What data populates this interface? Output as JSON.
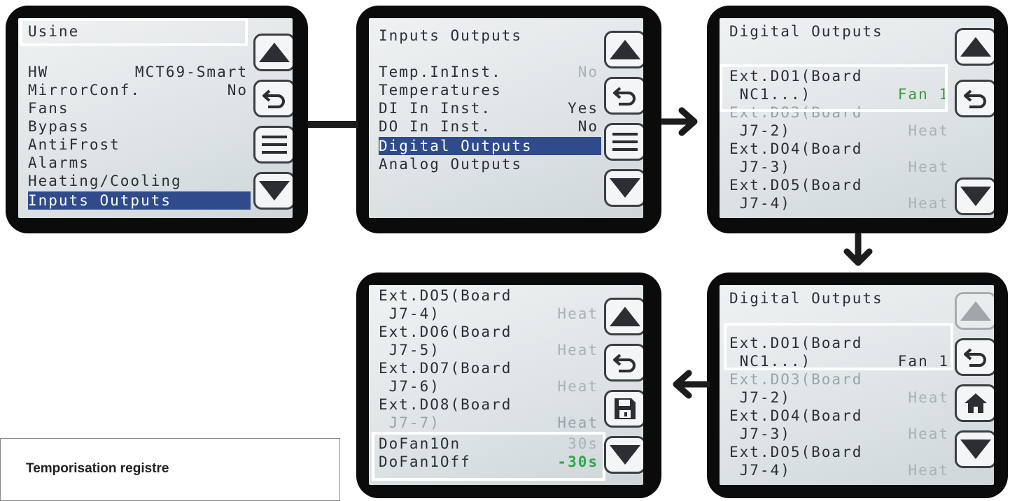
{
  "screens": {
    "s1": {
      "lines": [
        {
          "t": "Usine",
          "r": ""
        },
        {
          "t": "",
          "r": ""
        },
        {
          "t": "HW",
          "r": "MCT69-Smart"
        },
        {
          "t": "MirrorConf.",
          "r": "No"
        },
        {
          "t": "Fans",
          "r": ""
        },
        {
          "t": "Bypass",
          "r": ""
        },
        {
          "t": "AntiFrost",
          "r": ""
        },
        {
          "t": "Alarms",
          "r": ""
        },
        {
          "t": "Heating/Cooling",
          "r": ""
        },
        {
          "t": "Inputs Outputs",
          "r": ""
        }
      ]
    },
    "s2": {
      "lines": [
        {
          "t": "Inputs Outputs",
          "r": ""
        },
        {
          "t": "Temp.InInst.",
          "r": "No"
        },
        {
          "t": "Temperatures",
          "r": ""
        },
        {
          "t": "DI In Inst.",
          "r": "Yes"
        },
        {
          "t": "DO In Inst.",
          "r": "No"
        },
        {
          "t": "Digital Outputs",
          "r": ""
        },
        {
          "t": "Analog Outputs",
          "r": ""
        }
      ]
    },
    "s3": {
      "lines": [
        {
          "t": "Digital Outputs",
          "r": ""
        },
        {
          "t": "Ext.DO1(Board",
          "r": ""
        },
        {
          "t": " NC1...)",
          "r": "Fan 1"
        },
        {
          "t": "Ext.DO3(Board",
          "r": ""
        },
        {
          "t": " J7-2)",
          "r": "Heat"
        },
        {
          "t": "Ext.DO4(Board",
          "r": ""
        },
        {
          "t": " J7-3)",
          "r": "Heat"
        },
        {
          "t": "Ext.DO5(Board",
          "r": ""
        },
        {
          "t": " J7-4)",
          "r": "Heat"
        }
      ]
    },
    "s4": {
      "lines": [
        {
          "t": "Digital Outputs",
          "r": ""
        },
        {
          "t": "Ext.DO1(Board",
          "r": ""
        },
        {
          "t": " NC1...)",
          "r": "Fan 1"
        },
        {
          "t": "Ext.DO3(Board",
          "r": ""
        },
        {
          "t": " J7-2)",
          "r": "Heat"
        },
        {
          "t": "Ext.DO4(Board",
          "r": ""
        },
        {
          "t": " J7-3)",
          "r": "Heat"
        },
        {
          "t": "Ext.DO5(Board",
          "r": ""
        },
        {
          "t": " J7-4)",
          "r": "Heat"
        }
      ]
    },
    "s5": {
      "lines": [
        {
          "t": "Ext.DO5(Board",
          "r": ""
        },
        {
          "t": " J7-4)",
          "r": "Heat"
        },
        {
          "t": "Ext.DO6(Board",
          "r": ""
        },
        {
          "t": " J7-5)",
          "r": "Heat"
        },
        {
          "t": "Ext.DO7(Board",
          "r": ""
        },
        {
          "t": " J7-6)",
          "r": "Heat"
        },
        {
          "t": "Ext.DO8(Board",
          "r": ""
        },
        {
          "t": " J7-7)",
          "r": "Heat"
        },
        {
          "t": "DoFan1On",
          "r": "30s"
        },
        {
          "t": "DoFan1Off",
          "r": "-30s"
        }
      ]
    }
  },
  "caption": "Temporisation registre",
  "icons": [
    "up-arrow-icon",
    "back-arrow-icon",
    "menu-icon",
    "down-arrow-icon",
    "save-icon",
    "home-icon",
    "flow-arrow-icon"
  ],
  "colors": {
    "selection": "#2f4b8c",
    "value_green": "#3c9a3c",
    "highlight_frame": "#ffffff",
    "bezel": "#0b0b0b"
  }
}
